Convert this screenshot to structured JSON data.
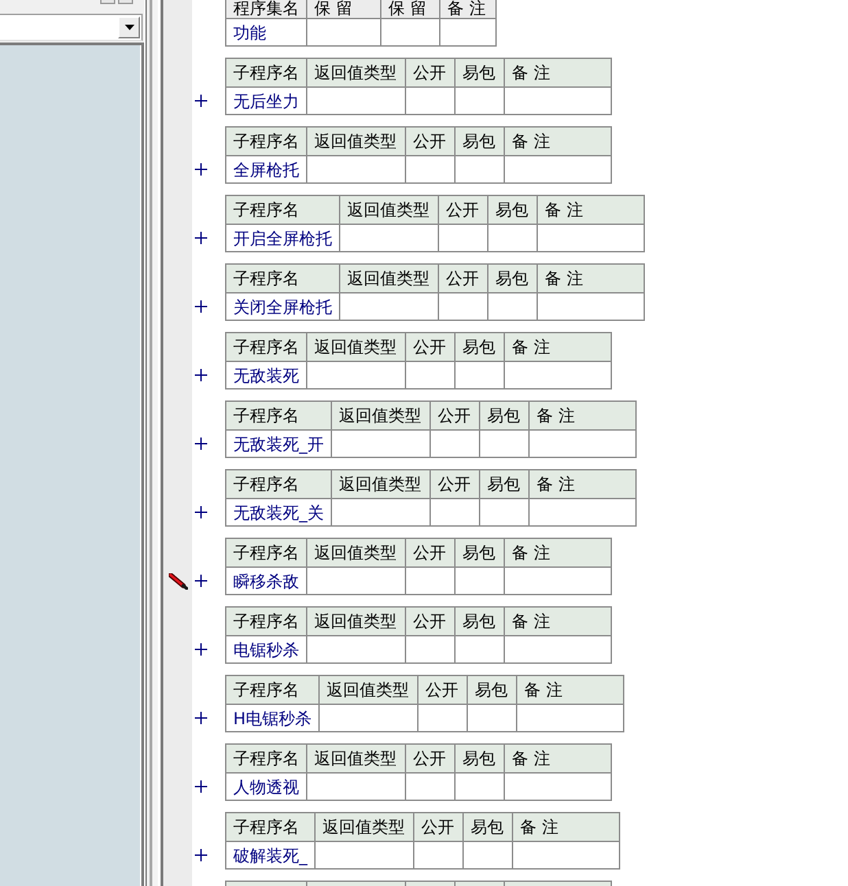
{
  "assembly_table": {
    "columns": [
      "程序集名",
      "保 留",
      "保 留",
      "备 注"
    ],
    "name": "功能"
  },
  "procedures": [
    {
      "columns": [
        "子程序名",
        "返回值类型",
        "公开",
        "易包",
        "备 注"
      ],
      "name": "无后坐力",
      "expanded": false,
      "current": false
    },
    {
      "columns": [
        "子程序名",
        "返回值类型",
        "公开",
        "易包",
        "备 注"
      ],
      "name": "全屏枪托",
      "expanded": false,
      "current": false
    },
    {
      "columns": [
        "子程序名",
        "返回值类型",
        "公开",
        "易包",
        "备 注"
      ],
      "name": "开启全屏枪托",
      "expanded": false,
      "current": false
    },
    {
      "columns": [
        "子程序名",
        "返回值类型",
        "公开",
        "易包",
        "备 注"
      ],
      "name": "关闭全屏枪托",
      "expanded": false,
      "current": false
    },
    {
      "columns": [
        "子程序名",
        "返回值类型",
        "公开",
        "易包",
        "备 注"
      ],
      "name": "无敌装死",
      "expanded": false,
      "current": false
    },
    {
      "columns": [
        "子程序名",
        "返回值类型",
        "公开",
        "易包",
        "备 注"
      ],
      "name": "无敌装死_开",
      "expanded": false,
      "current": false
    },
    {
      "columns": [
        "子程序名",
        "返回值类型",
        "公开",
        "易包",
        "备 注"
      ],
      "name": "无敌装死_关",
      "expanded": false,
      "current": false
    },
    {
      "columns": [
        "子程序名",
        "返回值类型",
        "公开",
        "易包",
        "备 注"
      ],
      "name": "瞬移杀敌",
      "expanded": false,
      "current": true
    },
    {
      "columns": [
        "子程序名",
        "返回值类型",
        "公开",
        "易包",
        "备 注"
      ],
      "name": "电锯秒杀",
      "expanded": false,
      "current": false
    },
    {
      "columns": [
        "子程序名",
        "返回值类型",
        "公开",
        "易包",
        "备 注"
      ],
      "name": "H电锯秒杀",
      "expanded": false,
      "current": false
    },
    {
      "columns": [
        "子程序名",
        "返回值类型",
        "公开",
        "易包",
        "备 注"
      ],
      "name": "人物透视",
      "expanded": false,
      "current": false
    },
    {
      "columns": [
        "子程序名",
        "返回值类型",
        "公开",
        "易包",
        "备 注"
      ],
      "name": "破解装死_",
      "expanded": false,
      "current": false
    }
  ],
  "next_table_cut_off": true
}
